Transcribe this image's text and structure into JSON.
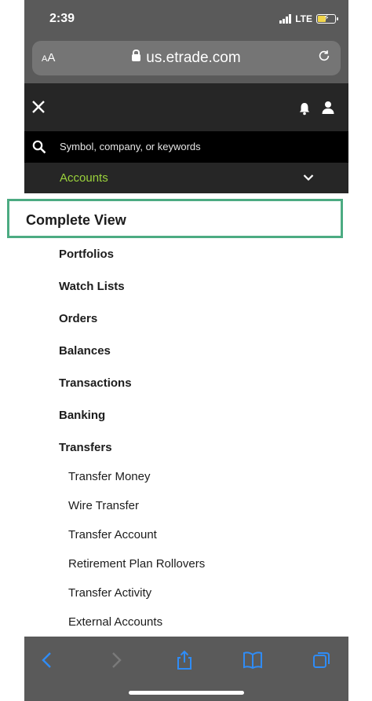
{
  "status": {
    "time": "2:39",
    "network": "LTE"
  },
  "browser": {
    "text_size": "AA",
    "url": "us.etrade.com"
  },
  "search": {
    "placeholder": "Symbol, company, or keywords"
  },
  "nav": {
    "section": "Accounts"
  },
  "menu": {
    "highlighted": "Complete View",
    "items": [
      "Portfolios",
      "Watch Lists",
      "Orders",
      "Balances",
      "Transactions",
      "Banking",
      "Transfers"
    ],
    "transfer_sub": [
      "Transfer Money",
      "Wire Transfer",
      "Transfer Account",
      "Retirement Plan Rollovers",
      "Transfer Activity",
      "External Accounts"
    ]
  },
  "icons": {
    "close": "close-icon",
    "bell": "bell-icon",
    "person": "person-icon",
    "search": "search-icon",
    "chevron": "chevron-down-icon",
    "back": "back-arrow-icon",
    "forward": "forward-arrow-icon",
    "share": "share-icon",
    "bookmarks": "book-icon",
    "tabs": "tabs-icon",
    "reload": "reload-icon",
    "lock": "lock-icon"
  },
  "colors": {
    "accent_green": "#9bd33c",
    "highlight_border": "#4cab82",
    "toolbar_blue": "#2f8cf6",
    "header_dark": "#262626"
  }
}
